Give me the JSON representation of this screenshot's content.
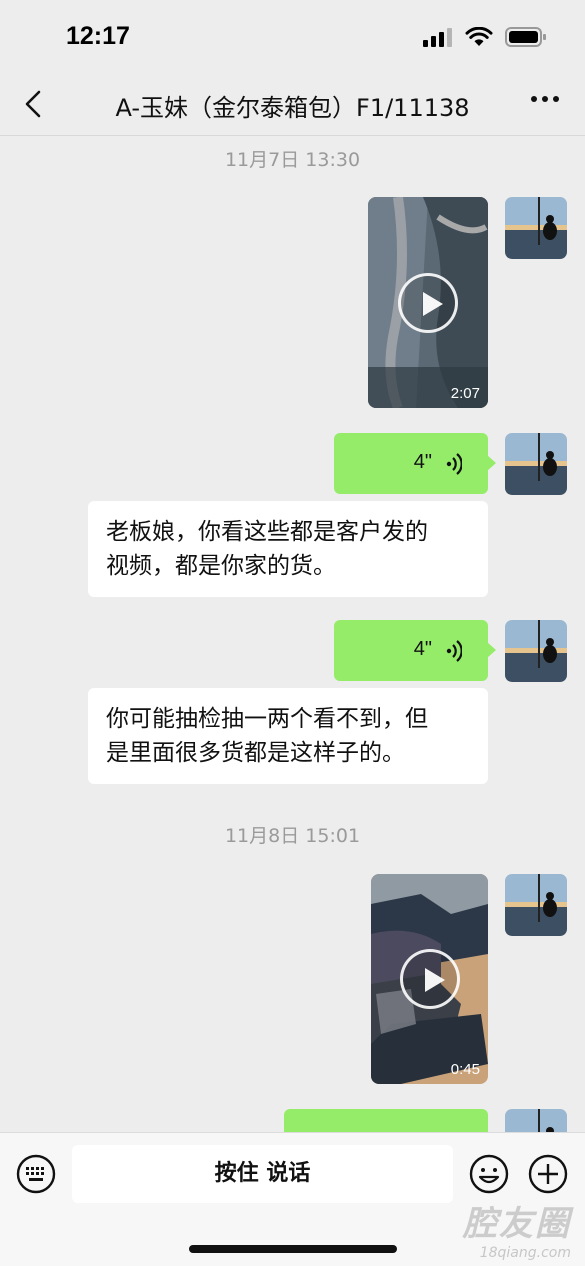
{
  "status": {
    "time": "12:17"
  },
  "nav": {
    "title": "A-玉妹（金尔泰箱包）F1/11138"
  },
  "chat": {
    "timestamps": [
      "11月7日 13:30",
      "11月8日 15:01"
    ],
    "messages": [
      {
        "type": "video",
        "sender": "me",
        "duration": "2:07"
      },
      {
        "type": "voice",
        "sender": "me",
        "duration": "4\""
      },
      {
        "type": "text",
        "sender": "other",
        "text": "老板娘，你看这些都是客户发的视频，都是你家的货。"
      },
      {
        "type": "voice",
        "sender": "me",
        "duration": "4\""
      },
      {
        "type": "text",
        "sender": "other",
        "text": "你可能抽检抽一两个看不到，但是里面很多货都是这样子的。"
      },
      {
        "type": "video",
        "sender": "me",
        "duration": "0:45"
      },
      {
        "type": "text",
        "sender": "me",
        "text": "..."
      }
    ],
    "text_lines": {
      "m1": [
        "老板娘，你看这些都是客户发的",
        "视频，都是你家的货。"
      ],
      "m2": [
        "你可能抽检抽一两个看不到，但",
        "是里面很多货都是这样子的。"
      ]
    }
  },
  "input": {
    "hold_to_talk": "按住 说话"
  },
  "watermark": {
    "brand": "腔友圈",
    "url": "18qiang.com"
  },
  "colors": {
    "background": "#ededed",
    "voice_bubble": "#95ec69",
    "text_bubble": "#ffffff"
  }
}
